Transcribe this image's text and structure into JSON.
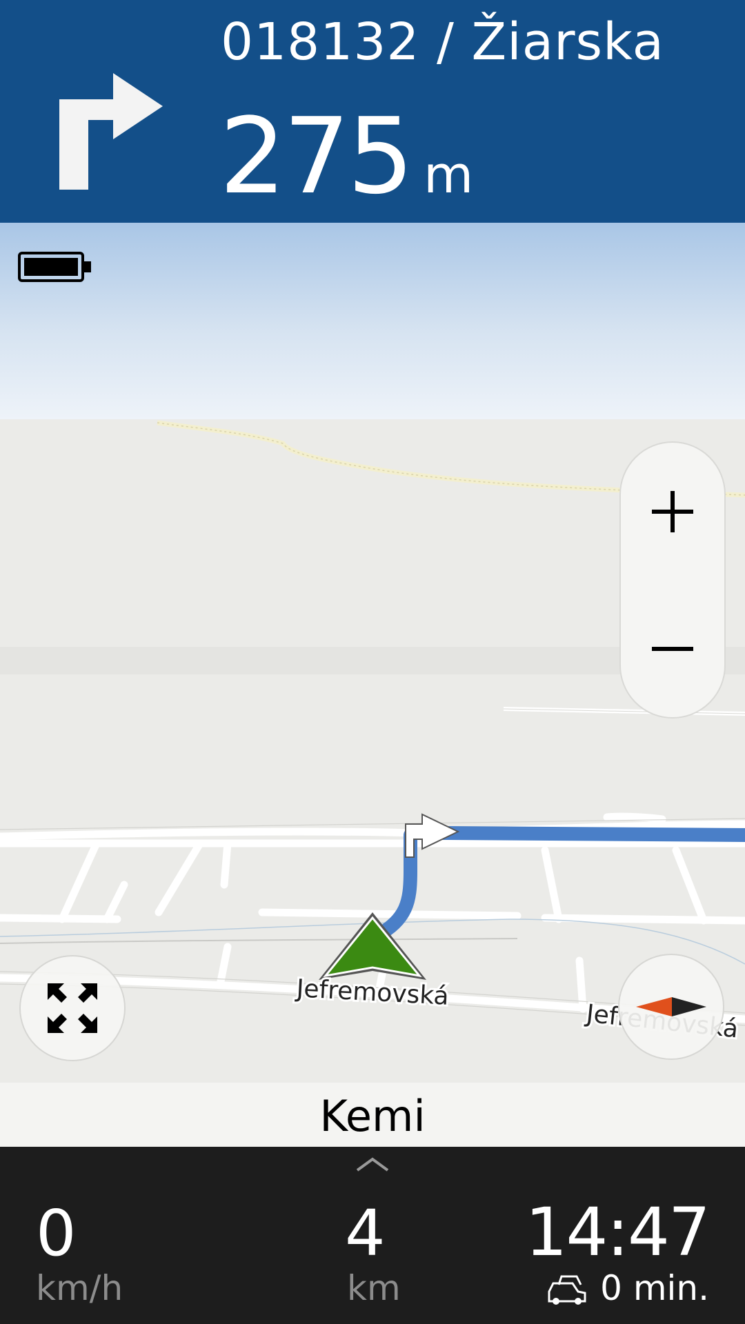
{
  "instruction": {
    "maneuver_icon": "turn-right-icon",
    "street": "018132 / Žiarska",
    "distance_value": "275",
    "distance_unit": "m"
  },
  "map": {
    "battery_icon": "battery-icon",
    "zoom_in_label": "+",
    "zoom_out_label": "–",
    "street_label_main": "Jefremovská",
    "street_label_right": "Jefremovská",
    "expand_icon": "expand-arrows-icon",
    "compass_icon": "compass-icon",
    "route_color": "#4a7fc8",
    "position_marker_color": "#3b8a12",
    "header_color": "#134f89"
  },
  "city": "Kemi",
  "bottom_bar": {
    "speed_value": "0",
    "speed_unit": "km/h",
    "distance_value": "4",
    "distance_unit": "km",
    "eta": "14:47",
    "traffic_delay": "0 min."
  }
}
